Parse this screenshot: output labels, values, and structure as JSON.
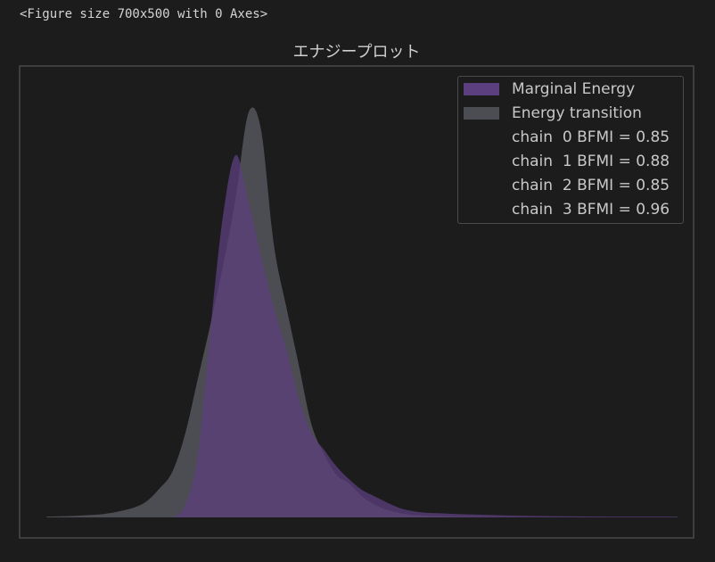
{
  "stdout": "<Figure size 700x500 with 0 Axes>",
  "chart_data": {
    "type": "area",
    "title": "エナジープロット",
    "xlabel": "",
    "ylabel": "",
    "grid": false,
    "legend_position": "top-right",
    "series": [
      {
        "name": "Marginal Energy",
        "color": "#5b3f7e",
        "x": [
          -4.0,
          -3.5,
          -3.0,
          -2.5,
          -2.2,
          -2.0,
          -1.8,
          -1.6,
          -1.4,
          -1.2,
          -1.0,
          -0.8,
          -0.6,
          -0.4,
          -0.2,
          0.0,
          0.2,
          0.4,
          0.6,
          0.8,
          1.0,
          1.2,
          1.4,
          1.6,
          1.8,
          2.0,
          2.2,
          2.5,
          3.0,
          3.5,
          4.0,
          5.0,
          6.0
        ],
        "values": [
          0.0,
          0.0,
          0.0,
          0.0,
          0.0,
          0.0,
          0.03,
          0.15,
          0.45,
          0.72,
          0.86,
          0.75,
          0.62,
          0.5,
          0.4,
          0.28,
          0.2,
          0.16,
          0.12,
          0.09,
          0.065,
          0.05,
          0.035,
          0.022,
          0.015,
          0.011,
          0.01,
          0.008,
          0.006,
          0.004,
          0.003,
          0.002,
          0.002
        ]
      },
      {
        "name": "Energy transition",
        "color": "#4c4d52",
        "x": [
          -4.0,
          -3.5,
          -3.0,
          -2.5,
          -2.2,
          -2.0,
          -1.8,
          -1.6,
          -1.4,
          -1.2,
          -1.0,
          -0.8,
          -0.6,
          -0.4,
          -0.2,
          0.0,
          0.2,
          0.4,
          0.6,
          0.8,
          1.0,
          1.2,
          1.4,
          1.6,
          1.8,
          2.0,
          2.2,
          2.5,
          3.0,
          3.5,
          4.0,
          5.0,
          6.0
        ],
        "values": [
          0.002,
          0.004,
          0.01,
          0.03,
          0.07,
          0.11,
          0.2,
          0.33,
          0.46,
          0.6,
          0.76,
          0.96,
          0.92,
          0.65,
          0.5,
          0.36,
          0.22,
          0.15,
          0.1,
          0.08,
          0.05,
          0.03,
          0.018,
          0.01,
          0.006,
          0.004,
          0.003,
          0.002,
          0.001,
          0.0,
          0.0,
          0.0,
          0.0
        ]
      }
    ],
    "overlap_color": "#5a5566",
    "legend_entries": [
      "Marginal Energy",
      "Energy transition",
      "chain  0 BFMI = 0.85",
      "chain  1 BFMI = 0.88",
      "chain  2 BFMI = 0.85",
      "chain  3 BFMI = 0.96"
    ],
    "xlim": [
      -4.2,
      6.0
    ],
    "ylim": [
      0,
      1.05
    ]
  }
}
